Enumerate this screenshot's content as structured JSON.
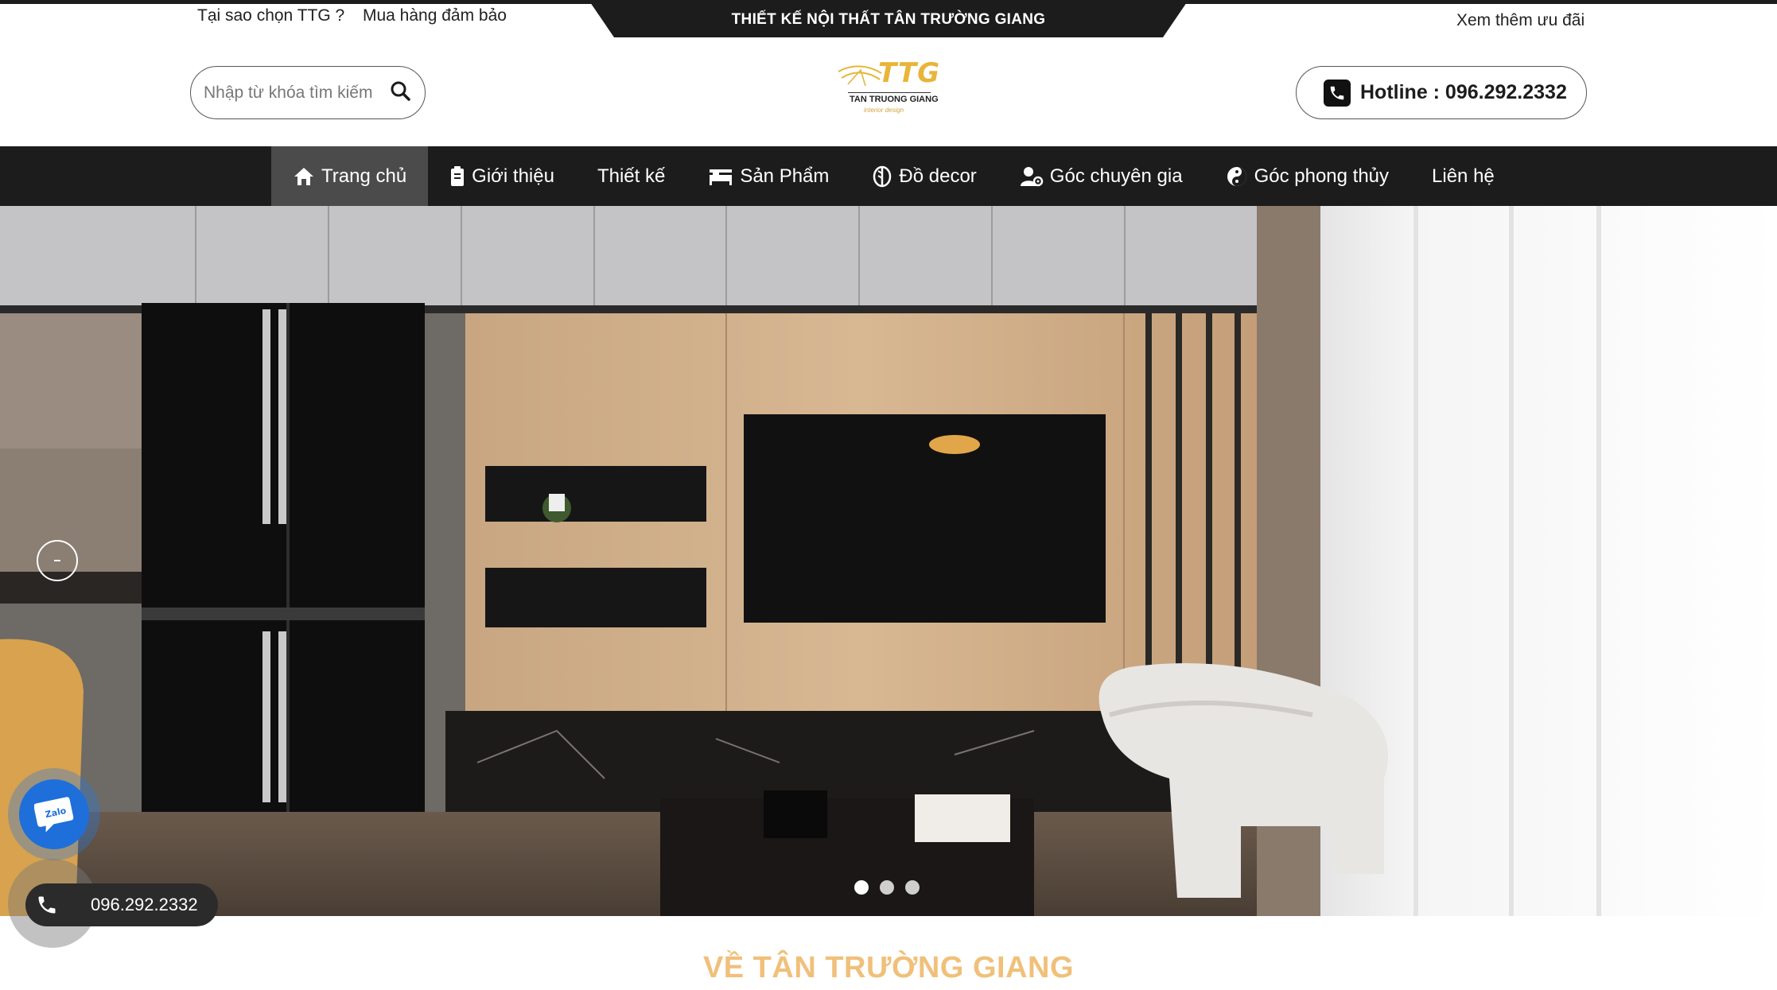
{
  "topbar": {
    "why_link": "Tại sao chọn TTG ?",
    "guarantee_link": "Mua hàng đảm bảo",
    "banner": "THIẾT KẾ NỘI THẤT TÂN TRƯỜNG GIANG",
    "offers_link": "Xem thêm ưu đãi"
  },
  "search": {
    "placeholder": "Nhập từ khóa tìm kiếm",
    "icon": "search-icon"
  },
  "logo": {
    "mark": "TTG",
    "name": "TAN TRUONG GIANG",
    "tagline": "interior design"
  },
  "hotline": {
    "label": "Hotline : 096.292.2332",
    "icon": "phone-icon"
  },
  "nav": {
    "items": [
      {
        "label": "Trang chủ",
        "icon": "home-icon",
        "active": true
      },
      {
        "label": "Giới thiệu",
        "icon": "document-icon"
      },
      {
        "label": "Thiết kế"
      },
      {
        "label": "Sản Phẩm",
        "icon": "bed-icon"
      },
      {
        "label": "Đồ decor",
        "icon": "leaf-icon"
      },
      {
        "label": "Góc chuyên gia",
        "icon": "user-gear-icon"
      },
      {
        "label": "Góc phong thủy",
        "icon": "yin-yang-icon"
      },
      {
        "label": "Liên hệ"
      }
    ]
  },
  "slider": {
    "slide_count": 3,
    "active_slide": 1
  },
  "floating": {
    "zalo_label": "Zalo",
    "phone": "096.292.2332"
  },
  "section": {
    "title": "VỀ TÂN TRƯỜNG GIANG"
  },
  "colors": {
    "dark": "#1c1c1c",
    "nav_active": "#4b4b4b",
    "gold": "#e8b53a",
    "section_title": "#f0c07a",
    "zalo": "#1e6fd9"
  }
}
